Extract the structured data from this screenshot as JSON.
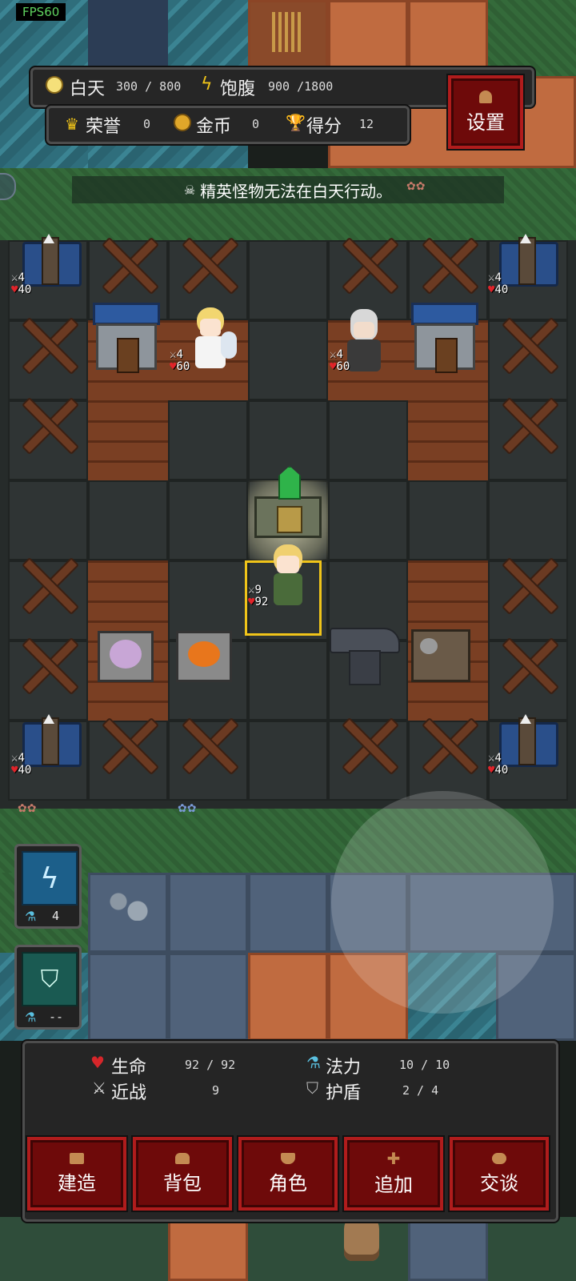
{
  "fps": "FPS60",
  "top_bar": {
    "day_label": "白天",
    "day_value": "300 / 800",
    "hunger_label": "饱腹",
    "hunger_value": "900 /1800",
    "honor_label": "荣誉",
    "honor_value": "0",
    "gold_label": "金币",
    "gold_value": "0",
    "score_label": "得分",
    "score_value": "12",
    "settings_label": "设置"
  },
  "notice": "精英怪物无法在白天行动。",
  "units": {
    "crossbow_tl": {
      "attack": "4",
      "hp": "40"
    },
    "crossbow_tr": {
      "attack": "4",
      "hp": "40"
    },
    "crossbow_bl": {
      "attack": "4",
      "hp": "40"
    },
    "crossbow_br": {
      "attack": "4",
      "hp": "40"
    },
    "angel": {
      "attack": "4",
      "hp": "60"
    },
    "knight": {
      "attack": "4",
      "hp": "60"
    },
    "hero": {
      "attack": "9",
      "hp": "92"
    }
  },
  "skills": {
    "lightning": {
      "cost": "4"
    },
    "shield": {
      "cost": "--"
    }
  },
  "stats": {
    "hp_label": "生命",
    "hp_value": "92 / 92",
    "mp_label": "法力",
    "mp_value": "10 / 10",
    "melee_label": "近战",
    "melee_value": "9",
    "shield_label": "护盾",
    "shield_value": "2 / 4"
  },
  "menu": [
    "建造",
    "背包",
    "角色",
    "追加",
    "交谈"
  ],
  "colors": {
    "accent_red": "#6e0a0a",
    "border_red": "#b01c1c",
    "highlight": "#f0c419"
  }
}
